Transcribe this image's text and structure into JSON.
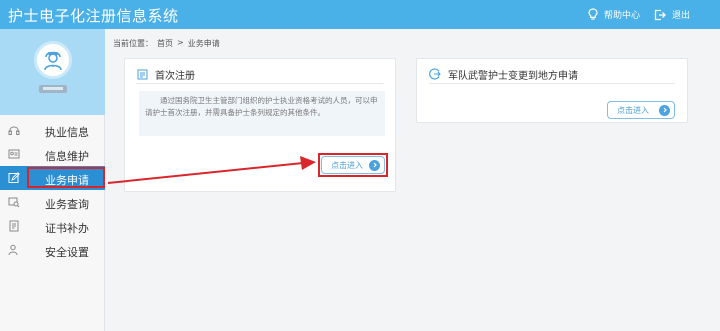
{
  "app": {
    "title": "护士电子化注册信息系统"
  },
  "header": {
    "help": {
      "label": "帮助中心",
      "icon": "lightbulb-icon"
    },
    "logout": {
      "label": "退出",
      "icon": "logout-icon"
    }
  },
  "sidebar": {
    "items": [
      {
        "label": "执业信息",
        "icon": "headset-icon",
        "active": false
      },
      {
        "label": "信息维护",
        "icon": "id-card-icon",
        "active": false
      },
      {
        "label": "业务申请",
        "icon": "edit-icon",
        "active": true
      },
      {
        "label": "业务查询",
        "icon": "search-list-icon",
        "active": false
      },
      {
        "label": "证书补办",
        "icon": "certificate-icon",
        "active": false
      },
      {
        "label": "安全设置",
        "icon": "user-lock-icon",
        "active": false
      }
    ]
  },
  "breadcrumb": {
    "prefix": "当前位置：",
    "home": "首页",
    "separator": ">",
    "current": "业务申请"
  },
  "cards": [
    {
      "title": "首次注册",
      "icon": "document-icon",
      "description": "通过国务院卫生主管部门组织的护士执业资格考试的人员，可以申请护士首次注册，并需具备护士条列规定的其他条件。",
      "button": "点击进入"
    },
    {
      "title": "军队武警护士变更到地方申请",
      "icon": "transfer-icon",
      "button": "点击进入"
    }
  ],
  "colors": {
    "header": "#4ab0e8",
    "accent": "#2b8fd4",
    "annotation": "#d9262c"
  }
}
